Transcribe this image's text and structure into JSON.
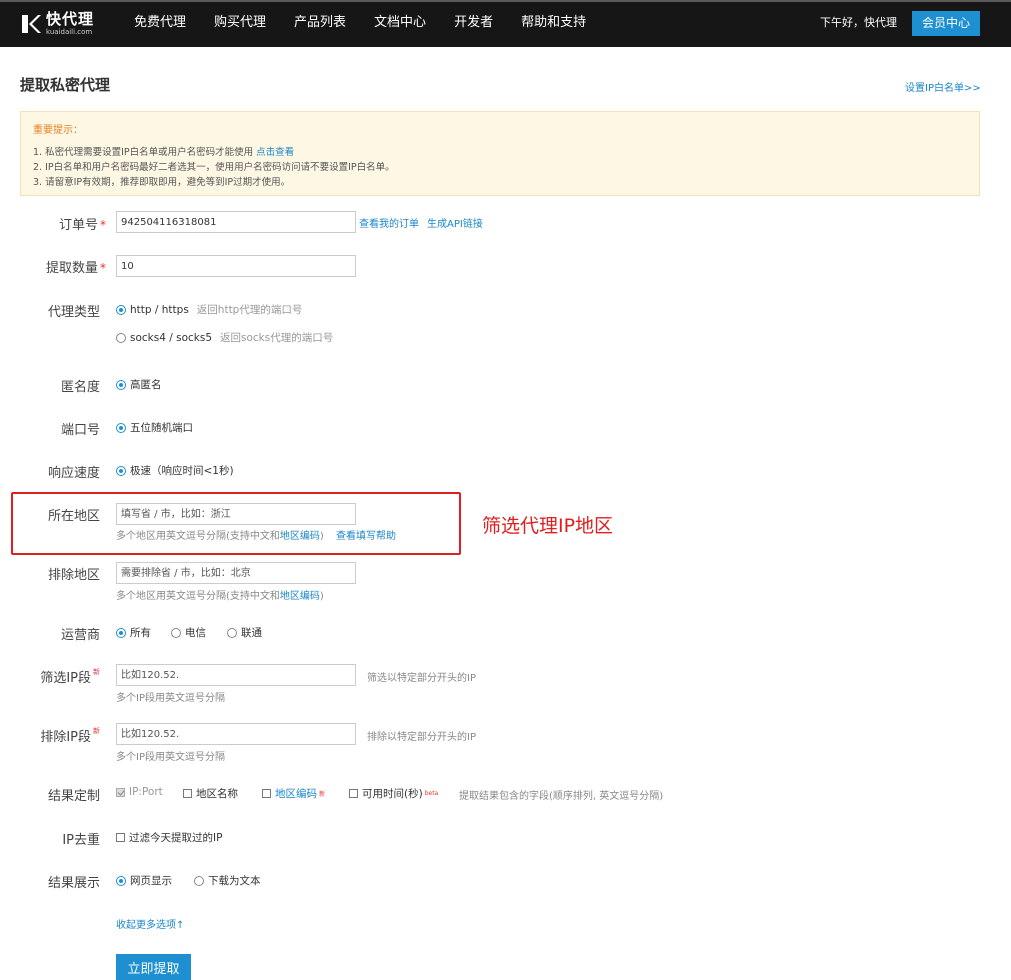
{
  "nav": {
    "logo_cn": "快代理",
    "logo_en": "kuaidaili.com",
    "items": [
      "免费代理",
      "购买代理",
      "产品列表",
      "文档中心",
      "开发者",
      "帮助和支持"
    ],
    "greeting": "下午好，快代理",
    "member_label": "会员中心"
  },
  "header": {
    "title": "提取私密代理",
    "whitelist_link": "设置IP白名单>>"
  },
  "notice": {
    "title": "重要提示：",
    "line1": "1. 私密代理需要设置IP白名单或用户名密码才能使用",
    "line1_link": "点击查看",
    "line2": "2. IP白名单和用户名密码最好二者选其一，使用用户名密码访问请不要设置IP白名单。",
    "line3": "3. 请留意IP有效期，推荐即取即用，避免等到IP过期才使用。"
  },
  "form": {
    "order": {
      "label": "订单号",
      "required": "*",
      "value": "942504116318081",
      "link1": "查看我的订单",
      "link2": "生成API链接"
    },
    "count": {
      "label": "提取数量",
      "required": "*",
      "value": "10"
    },
    "proxy_type": {
      "label": "代理类型",
      "opt1": "http / https",
      "opt1_desc": "返回http代理的端口号",
      "opt2": "socks4 / socks5",
      "opt2_desc": "返回socks代理的端口号"
    },
    "anonymity": {
      "label": "匿名度",
      "opt1": "高匿名"
    },
    "port": {
      "label": "端口号",
      "opt1": "五位随机端口"
    },
    "speed": {
      "label": "响应速度",
      "opt1": "极速（响应时间<1秒)"
    },
    "region": {
      "label": "所在地区",
      "placeholder": "填写省 / 市，比如：浙江",
      "hint": "多个地区用英文逗号分隔(支持中文和",
      "hint_link": "地区编码",
      "hint_tail": ")",
      "help_link": "查看填写帮助"
    },
    "exclude_region": {
      "label": "排除地区",
      "placeholder": "需要排除省 / 市，比如：北京",
      "hint": "多个地区用英文逗号分隔(支持中文和",
      "hint_link": "地区编码",
      "hint_tail": ")"
    },
    "carrier": {
      "label": "运营商",
      "opt1": "所有",
      "opt2": "电信",
      "opt3": "联通"
    },
    "filter_ip": {
      "label": "筛选IP段",
      "new": "新",
      "placeholder": "比如120.52.",
      "desc": "筛选以特定部分开头的IP",
      "hint": "多个IP段用英文逗号分隔"
    },
    "exclude_ip": {
      "label": "排除IP段",
      "new": "新",
      "placeholder": "比如120.52.",
      "desc": "排除以特定部分开头的IP",
      "hint": "多个IP段用英文逗号分隔"
    },
    "result_custom": {
      "label": "结果定制",
      "opt1": "IP:Port",
      "opt2": "地区名称",
      "opt3": "地区编码",
      "opt3_new": "新",
      "opt4": "可用时间(秒)",
      "opt4_beta": "beta",
      "desc": "提取结果包含的字段(顺序排列, 英文逗号分隔)"
    },
    "dedupe": {
      "label": "IP去重",
      "opt1": "过滤今天提取过的IP"
    },
    "display": {
      "label": "结果展示",
      "opt1": "网页显示",
      "opt2": "下载为文本"
    },
    "collapse_link": "收起更多选项↑",
    "submit_label": "立即提取"
  },
  "annotation": {
    "text": "筛选代理IP地区"
  },
  "colors": {
    "accent": "#1e8fd0",
    "link": "#1a86c8",
    "required": "#e33333",
    "annotation": "#e02020",
    "nav_bg": "#161616"
  }
}
